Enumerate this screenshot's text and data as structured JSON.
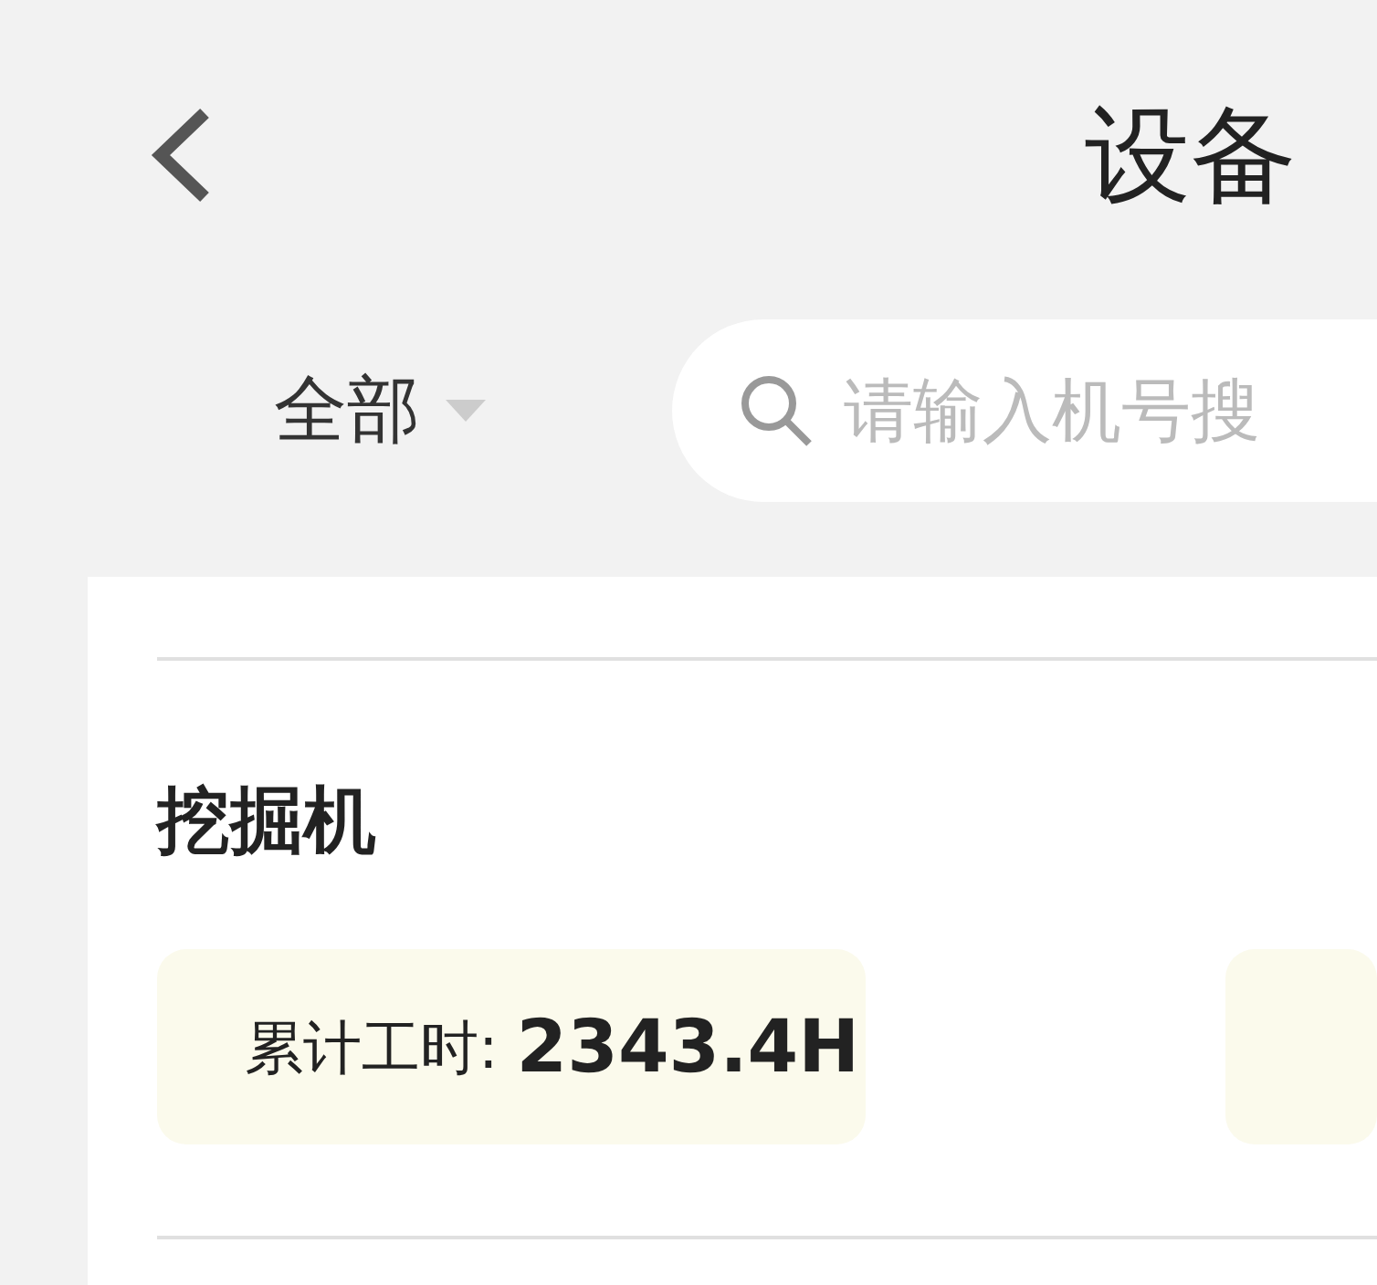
{
  "header": {
    "title": "设备"
  },
  "filter": {
    "label": "全部"
  },
  "search": {
    "placeholder": "请输入机号搜"
  },
  "device": {
    "name": "挖掘机",
    "stats": [
      {
        "label": "累计工时:",
        "value": "2343.4H"
      }
    ]
  }
}
